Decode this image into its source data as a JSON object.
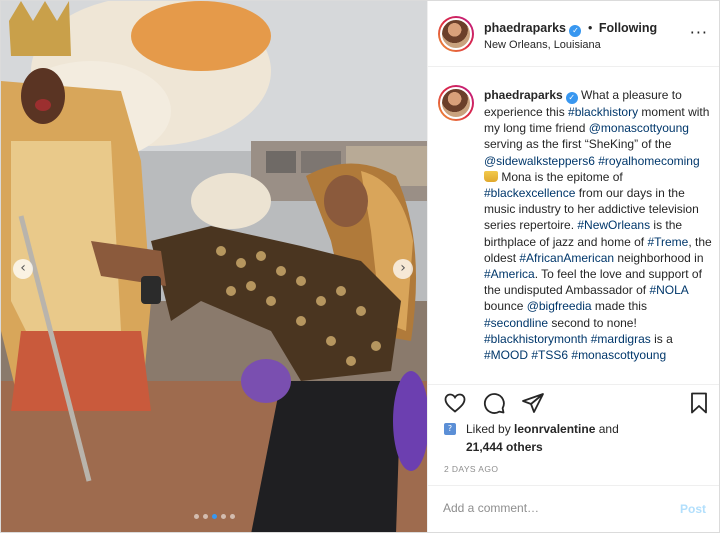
{
  "post": {
    "author": {
      "username": "phaedraparks",
      "verified": true,
      "following_label": "Following",
      "location": "New Orleans, Louisiana"
    },
    "more_icon": "more-options-icon",
    "caption_segments": [
      {
        "text": "phaedraparks",
        "kind": "user"
      },
      {
        "text": " ",
        "kind": "verified"
      },
      {
        "text": " What a pleasure to experience this ",
        "kind": "text"
      },
      {
        "text": "#blackhistory",
        "kind": "tag"
      },
      {
        "text": " moment with my long time friend ",
        "kind": "text"
      },
      {
        "text": "@monascottyoung",
        "kind": "tag"
      },
      {
        "text": " serving as the first “SheKing” of the ",
        "kind": "text"
      },
      {
        "text": "@sidewalksteppers6",
        "kind": "tag"
      },
      {
        "text": " ",
        "kind": "text"
      },
      {
        "text": "#royalhomecoming",
        "kind": "tag"
      },
      {
        "text": " ",
        "kind": "text"
      },
      {
        "text": "crown",
        "kind": "emoji"
      },
      {
        "text": " Mona is the epitome of ",
        "kind": "text"
      },
      {
        "text": "#blackexcellence",
        "kind": "tag"
      },
      {
        "text": " from our days in the music industry to her addictive television series repertoire. ",
        "kind": "text"
      },
      {
        "text": "#NewOrleans",
        "kind": "tag"
      },
      {
        "text": " is the birthplace of jazz and home of ",
        "kind": "text"
      },
      {
        "text": "#Treme",
        "kind": "tag"
      },
      {
        "text": ", the oldest ",
        "kind": "text"
      },
      {
        "text": "#AfricanAmerican",
        "kind": "tag"
      },
      {
        "text": " neighborhood in ",
        "kind": "text"
      },
      {
        "text": "#America",
        "kind": "tag"
      },
      {
        "text": ". To feel the love and support of the undisputed Ambassador of ",
        "kind": "text"
      },
      {
        "text": "#NOLA",
        "kind": "tag"
      },
      {
        "text": " bounce ",
        "kind": "text"
      },
      {
        "text": "@bigfreedia",
        "kind": "tag"
      },
      {
        "text": " made this ",
        "kind": "text"
      },
      {
        "text": "#secondline",
        "kind": "tag"
      },
      {
        "text": " second to none! ",
        "kind": "text"
      },
      {
        "text": "#blackhistorymonth",
        "kind": "tag"
      },
      {
        "text": " ",
        "kind": "text"
      },
      {
        "text": "#mardigras",
        "kind": "tag"
      },
      {
        "text": " is a ",
        "kind": "text"
      },
      {
        "text": "#MOOD",
        "kind": "tag"
      },
      {
        "text": " ",
        "kind": "text"
      },
      {
        "text": "#TSS6",
        "kind": "tag"
      },
      {
        "text": " ",
        "kind": "text"
      },
      {
        "text": "#monascottyoung",
        "kind": "tag"
      }
    ],
    "actions": {
      "like_icon": "heart-icon",
      "comment_icon": "comment-icon",
      "share_icon": "share-icon",
      "save_icon": "bookmark-icon"
    },
    "likes": {
      "prefix": "Liked by ",
      "user": "leonrvalentine",
      "suffix": " and",
      "others": "21,444 others"
    },
    "timestamp": "2 DAYS AGO",
    "comment": {
      "placeholder": "Add a comment…",
      "value": "",
      "post_label": "Post"
    },
    "carousel": {
      "slide_count": 5,
      "active_index": 2
    }
  },
  "colors": {
    "link": "#00376b",
    "verified": "#3897f0",
    "post_disabled": "#b2dffc",
    "muted": "#8e8e8e"
  }
}
